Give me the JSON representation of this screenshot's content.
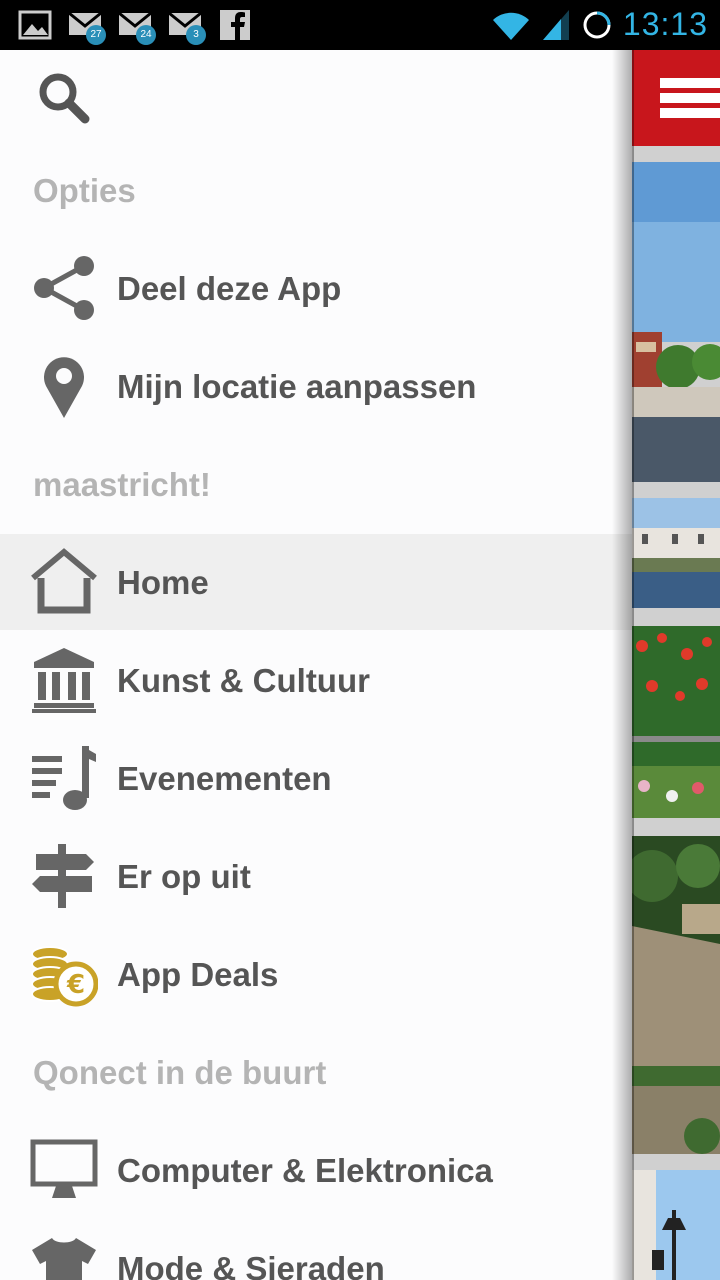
{
  "status_bar": {
    "time": "13:13",
    "badges": [
      "27",
      "24",
      "3"
    ]
  },
  "drawer": {
    "sections": {
      "options": "Opties",
      "city": "maastricht!",
      "nearby": "Qonect in de buurt"
    },
    "items": {
      "share": "Deel deze App",
      "location": "Mijn locatie aanpassen",
      "home": "Home",
      "art": "Kunst & Cultuur",
      "events": "Evenementen",
      "outing": "Er op uit",
      "deals": "App Deals",
      "computer": "Computer & Elektronica",
      "fashion": "Mode & Sieraden"
    },
    "active_item": "home"
  },
  "colors": {
    "accent_red": "#c8161c",
    "status_blue": "#33b5e5",
    "icon_gray": "#666666",
    "coin_gold": "#c9a227"
  }
}
